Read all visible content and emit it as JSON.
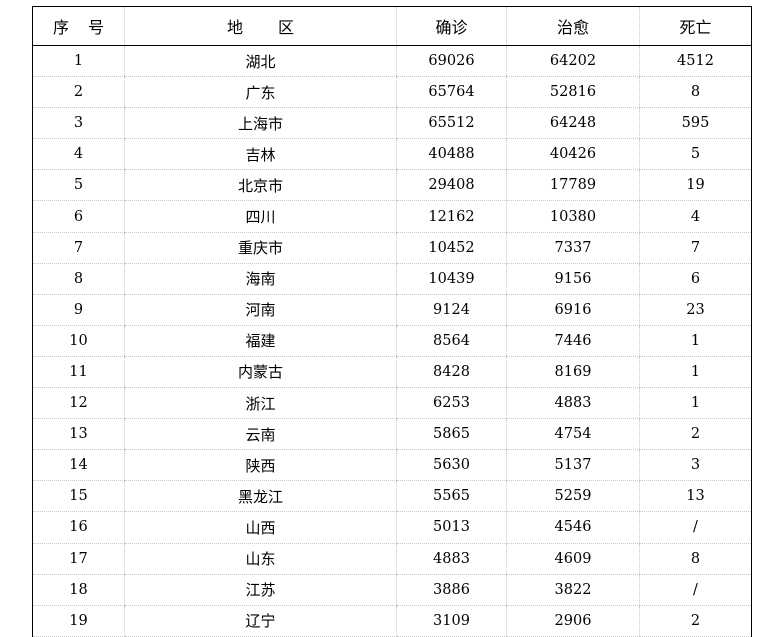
{
  "table": {
    "headers": [
      "序 号",
      "地 区",
      "确诊",
      "治愈",
      "死亡"
    ],
    "rows": [
      [
        "1",
        "湖北",
        "69026",
        "64202",
        "4512"
      ],
      [
        "2",
        "广东",
        "65764",
        "52816",
        "8"
      ],
      [
        "3",
        "上海市",
        "65512",
        "64248",
        "595"
      ],
      [
        "4",
        "吉林",
        "40488",
        "40426",
        "5"
      ],
      [
        "5",
        "北京市",
        "29408",
        "17789",
        "19"
      ],
      [
        "6",
        "四川",
        "12162",
        "10380",
        "4"
      ],
      [
        "7",
        "重庆市",
        "10452",
        "7337",
        "7"
      ],
      [
        "8",
        "海南",
        "10439",
        "9156",
        "6"
      ],
      [
        "9",
        "河南",
        "9124",
        "6916",
        "23"
      ],
      [
        "10",
        "福建",
        "8564",
        "7446",
        "1"
      ],
      [
        "11",
        "内蒙古",
        "8428",
        "8169",
        "1"
      ],
      [
        "12",
        "浙江",
        "6253",
        "4883",
        "1"
      ],
      [
        "13",
        "云南",
        "5865",
        "4754",
        "2"
      ],
      [
        "14",
        "陕西",
        "5630",
        "5137",
        "3"
      ],
      [
        "15",
        "黑龙江",
        "5565",
        "5259",
        "13"
      ],
      [
        "16",
        "山西",
        "5013",
        "4546",
        "/"
      ],
      [
        "17",
        "山东",
        "4883",
        "4609",
        "8"
      ],
      [
        "18",
        "江苏",
        "3886",
        "3822",
        "/"
      ],
      [
        "19",
        "辽宁",
        "3109",
        "2906",
        "2"
      ]
    ]
  }
}
